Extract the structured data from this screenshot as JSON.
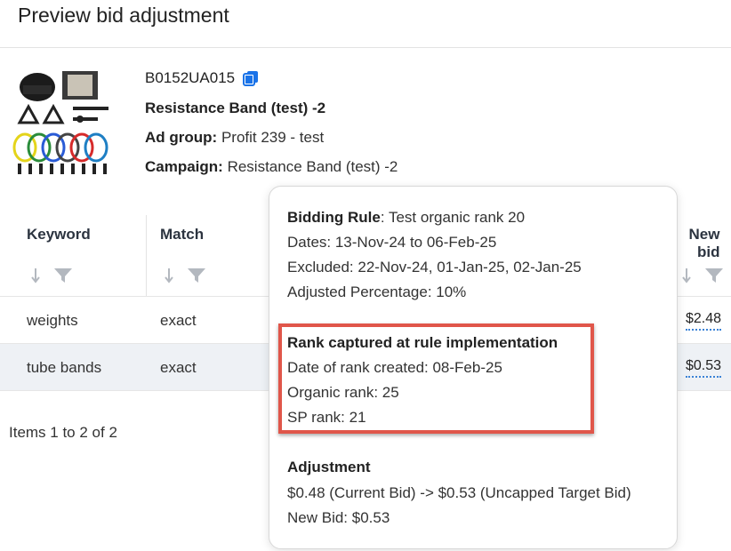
{
  "dialog": {
    "title": "Preview bid adjustment"
  },
  "product": {
    "asin": "B0152UA015",
    "name": "Resistance Band (test) -2",
    "ad_group_label": "Ad group:",
    "ad_group_value": "Profit 239 - test",
    "campaign_label": "Campaign:",
    "campaign_value": "Resistance Band (test) -2"
  },
  "table": {
    "headers": {
      "keyword": "Keyword",
      "match": "Match",
      "new_bid_line1": "New",
      "new_bid_line2": "bid"
    },
    "rows": [
      {
        "keyword": "weights",
        "match": "exact",
        "new_bid": "$2.48"
      },
      {
        "keyword": "tube bands",
        "match": "exact",
        "new_bid": "$0.53"
      }
    ],
    "pagination": "Items 1 to 2 of 2"
  },
  "tooltip": {
    "rule_label": "Bidding Rule",
    "rule_value": ": Test organic rank 20",
    "dates": "Dates: 13-Nov-24 to 06-Feb-25",
    "excluded": "Excluded: 22-Nov-24, 01-Jan-25, 02-Jan-25",
    "adjusted_pct": "Adjusted Percentage: 10%",
    "rank_heading": "Rank captured at rule implementation",
    "rank_date": "Date of rank created: 08-Feb-25",
    "organic_rank": "Organic rank: 25",
    "sp_rank": "SP rank: 21",
    "adjustment_heading": "Adjustment",
    "adjustment_detail": "$0.48 (Current Bid) -> $0.53 (Uncapped Target Bid)",
    "new_bid": "New Bid: $0.53"
  },
  "colors": {
    "highlight": "#e0564a",
    "link_underline": "#3b82d6",
    "copy_icon": "#1a73e8"
  }
}
